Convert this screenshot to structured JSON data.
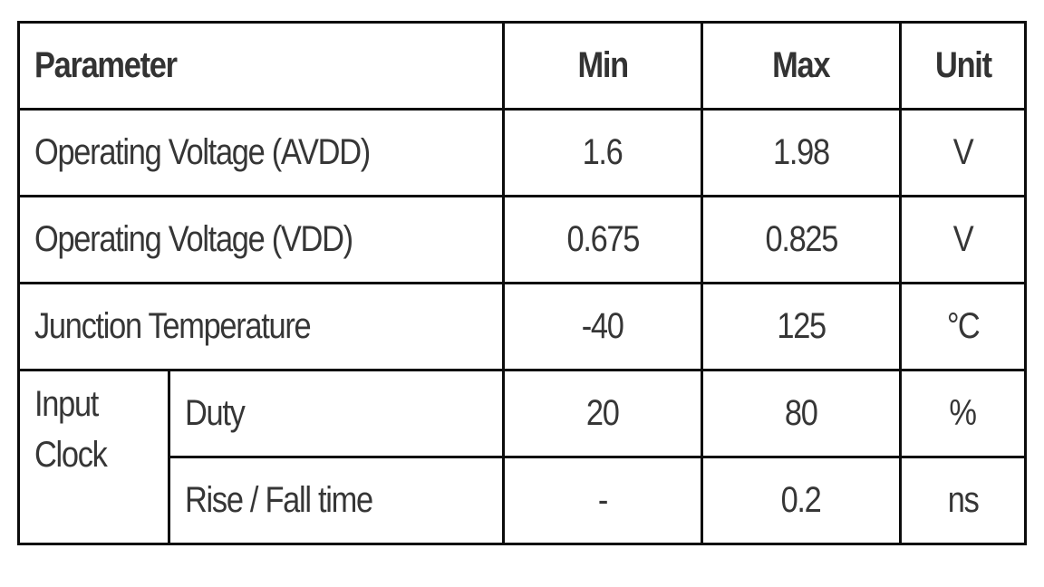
{
  "table": {
    "headers": {
      "parameter": "Parameter",
      "min": "Min",
      "max": "Max",
      "unit": "Unit"
    },
    "rows": [
      {
        "parameter": "Operating Voltage (AVDD)",
        "min": "1.6",
        "max": "1.98",
        "unit": "V"
      },
      {
        "parameter": "Operating Voltage (VDD)",
        "min": "0.675",
        "max": "0.825",
        "unit": "V"
      },
      {
        "parameter": "Junction Temperature",
        "min": "-40",
        "max": "125",
        "unit": "°C"
      }
    ],
    "group": {
      "label": "Input Clock",
      "rows": [
        {
          "parameter": "Duty",
          "min": "20",
          "max": "80",
          "unit": "%"
        },
        {
          "parameter": "Rise / Fall time",
          "min": "-",
          "max": "0.2",
          "unit": "ns"
        }
      ]
    }
  }
}
